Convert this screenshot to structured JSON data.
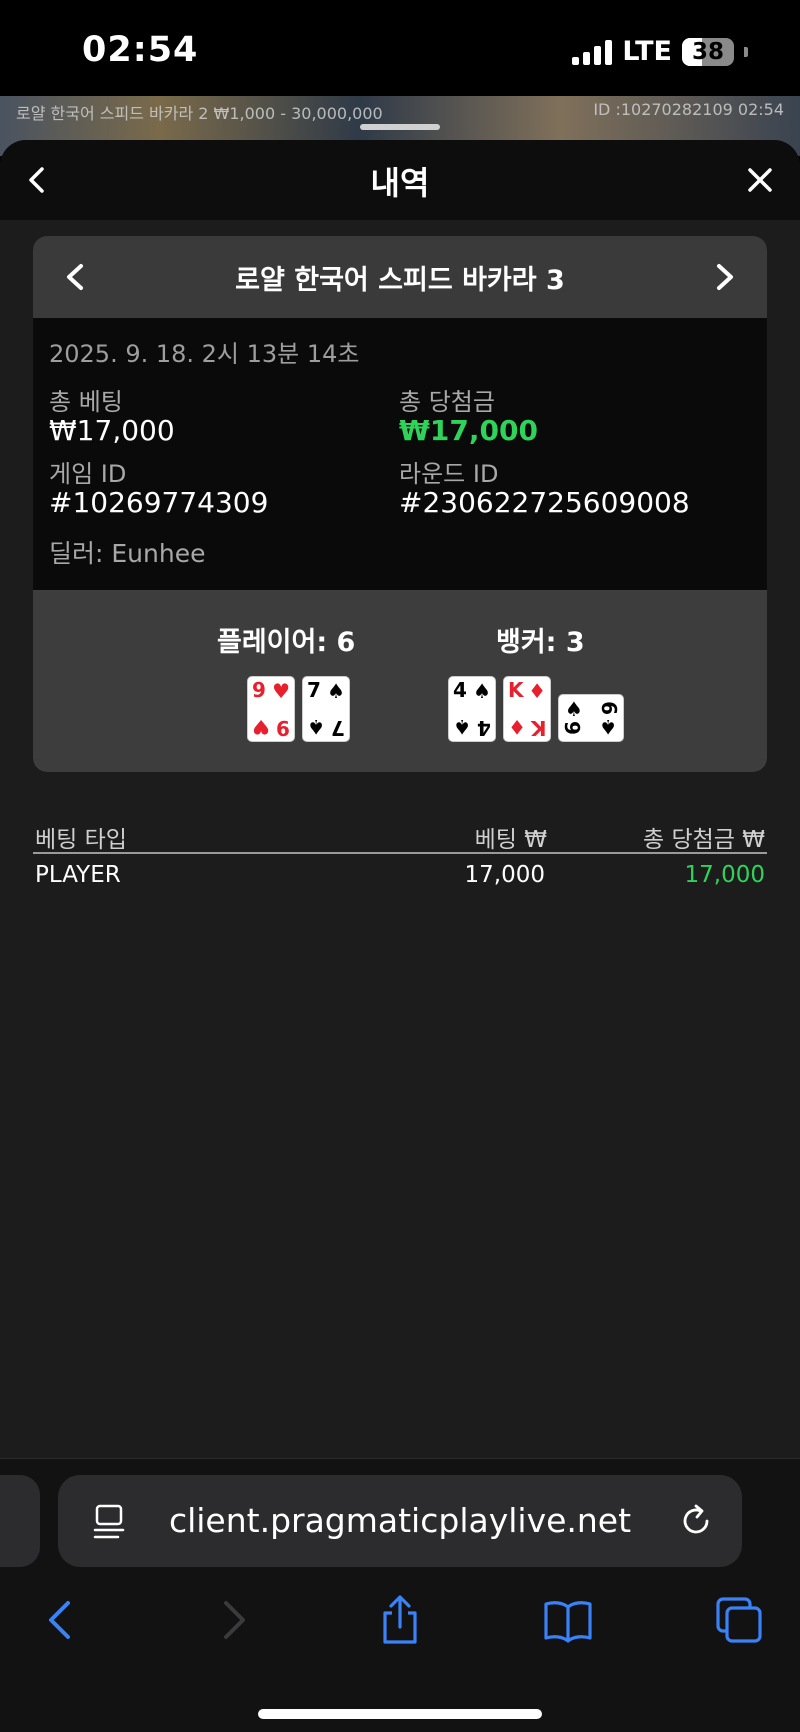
{
  "status_bar": {
    "time": "02:54",
    "network": "LTE",
    "battery": "38",
    "battery_level": 0.38
  },
  "background_game": {
    "title": "로얄 한국어 스피드 바카라 2 ₩1,000 - 30,000,000",
    "id_time": "ID :10270282109 02:54"
  },
  "sheet": {
    "title": "내역"
  },
  "game_card": {
    "title": "로얄 한국어 스피드 바카라 3",
    "date": "2025. 9. 18. 2시 13분 14초",
    "total_bet_label": "총 베팅",
    "total_bet_value": "₩17,000",
    "total_win_label": "총 당첨금",
    "total_win_value": "₩17,000",
    "game_id_label": "게임 ID",
    "game_id_value": "#10269774309",
    "round_id_label": "라운드 ID",
    "round_id_value": "#230622725609008",
    "dealer": "딜러: Eunhee"
  },
  "result": {
    "player_label": "플레이어: 6",
    "banker_label": "뱅커: 3",
    "player_cards": [
      {
        "rank": "9",
        "suit": "♥",
        "color": "red"
      },
      {
        "rank": "7",
        "suit": "♠",
        "color": "black"
      }
    ],
    "banker_cards": [
      {
        "rank": "4",
        "suit": "♠",
        "color": "black"
      },
      {
        "rank": "K",
        "suit": "♦",
        "color": "red"
      },
      {
        "rank": "9",
        "suit": "♠",
        "color": "black"
      }
    ]
  },
  "bets_table": {
    "headers": [
      "베팅 타입",
      "베팅 ₩",
      "총 당첨금 ₩"
    ],
    "rows": [
      {
        "type": "PLAYER",
        "bet": "17,000",
        "win": "17,000"
      }
    ]
  },
  "browser": {
    "url": "client.pragmaticplaylive.net"
  },
  "colors": {
    "win_green": "#2fd35a",
    "card_red": "#e8202e",
    "ios_blue": "#3a82f7"
  }
}
